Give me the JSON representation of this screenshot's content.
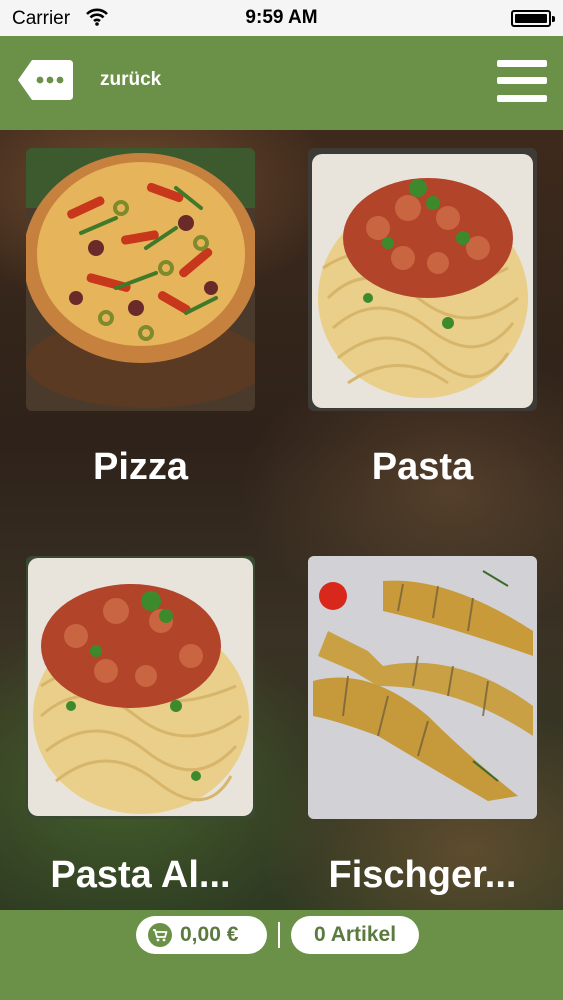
{
  "status_bar": {
    "carrier": "Carrier",
    "time": "9:59 AM"
  },
  "nav": {
    "back_label": "zurück"
  },
  "categories": [
    {
      "title": "Pizza"
    },
    {
      "title": "Pasta"
    },
    {
      "title": "Pasta Al..."
    },
    {
      "title": "Fischger..."
    }
  ],
  "cart": {
    "price": "0,00 €",
    "count": "0 Artikel"
  },
  "colors": {
    "brand_green": "#6a9147",
    "text_white": "#ffffff"
  }
}
